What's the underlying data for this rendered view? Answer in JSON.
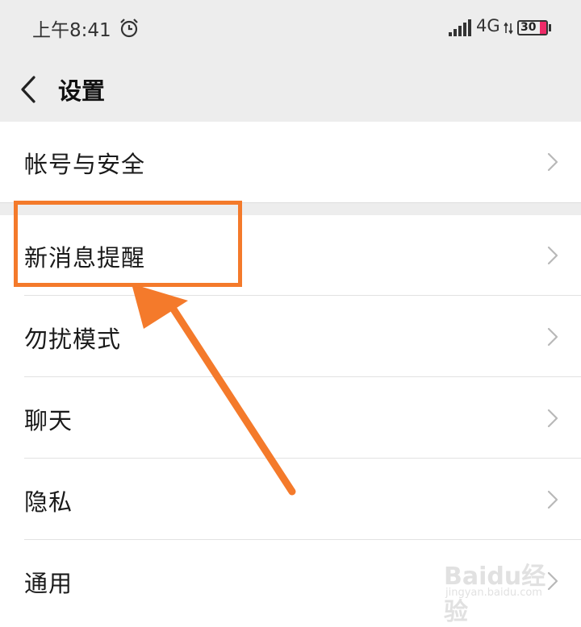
{
  "status": {
    "time": "上午8:41",
    "network": "4G",
    "battery": "30",
    "battery_color": "#ee2b68"
  },
  "header": {
    "title": "设置",
    "back_icon": "chevron-left-icon"
  },
  "settings": {
    "items": [
      {
        "label": "帐号与安全"
      },
      {
        "label": "新消息提醒"
      },
      {
        "label": "勿扰模式"
      },
      {
        "label": "聊天"
      },
      {
        "label": "隐私"
      },
      {
        "label": "通用"
      }
    ],
    "row_icon": "chevron-right-icon"
  },
  "annotation": {
    "color": "#f47a2b",
    "highlighted_item": "新消息提醒"
  },
  "watermark": {
    "brand": "Baidu经验",
    "url": "jingyan.baidu.com"
  }
}
